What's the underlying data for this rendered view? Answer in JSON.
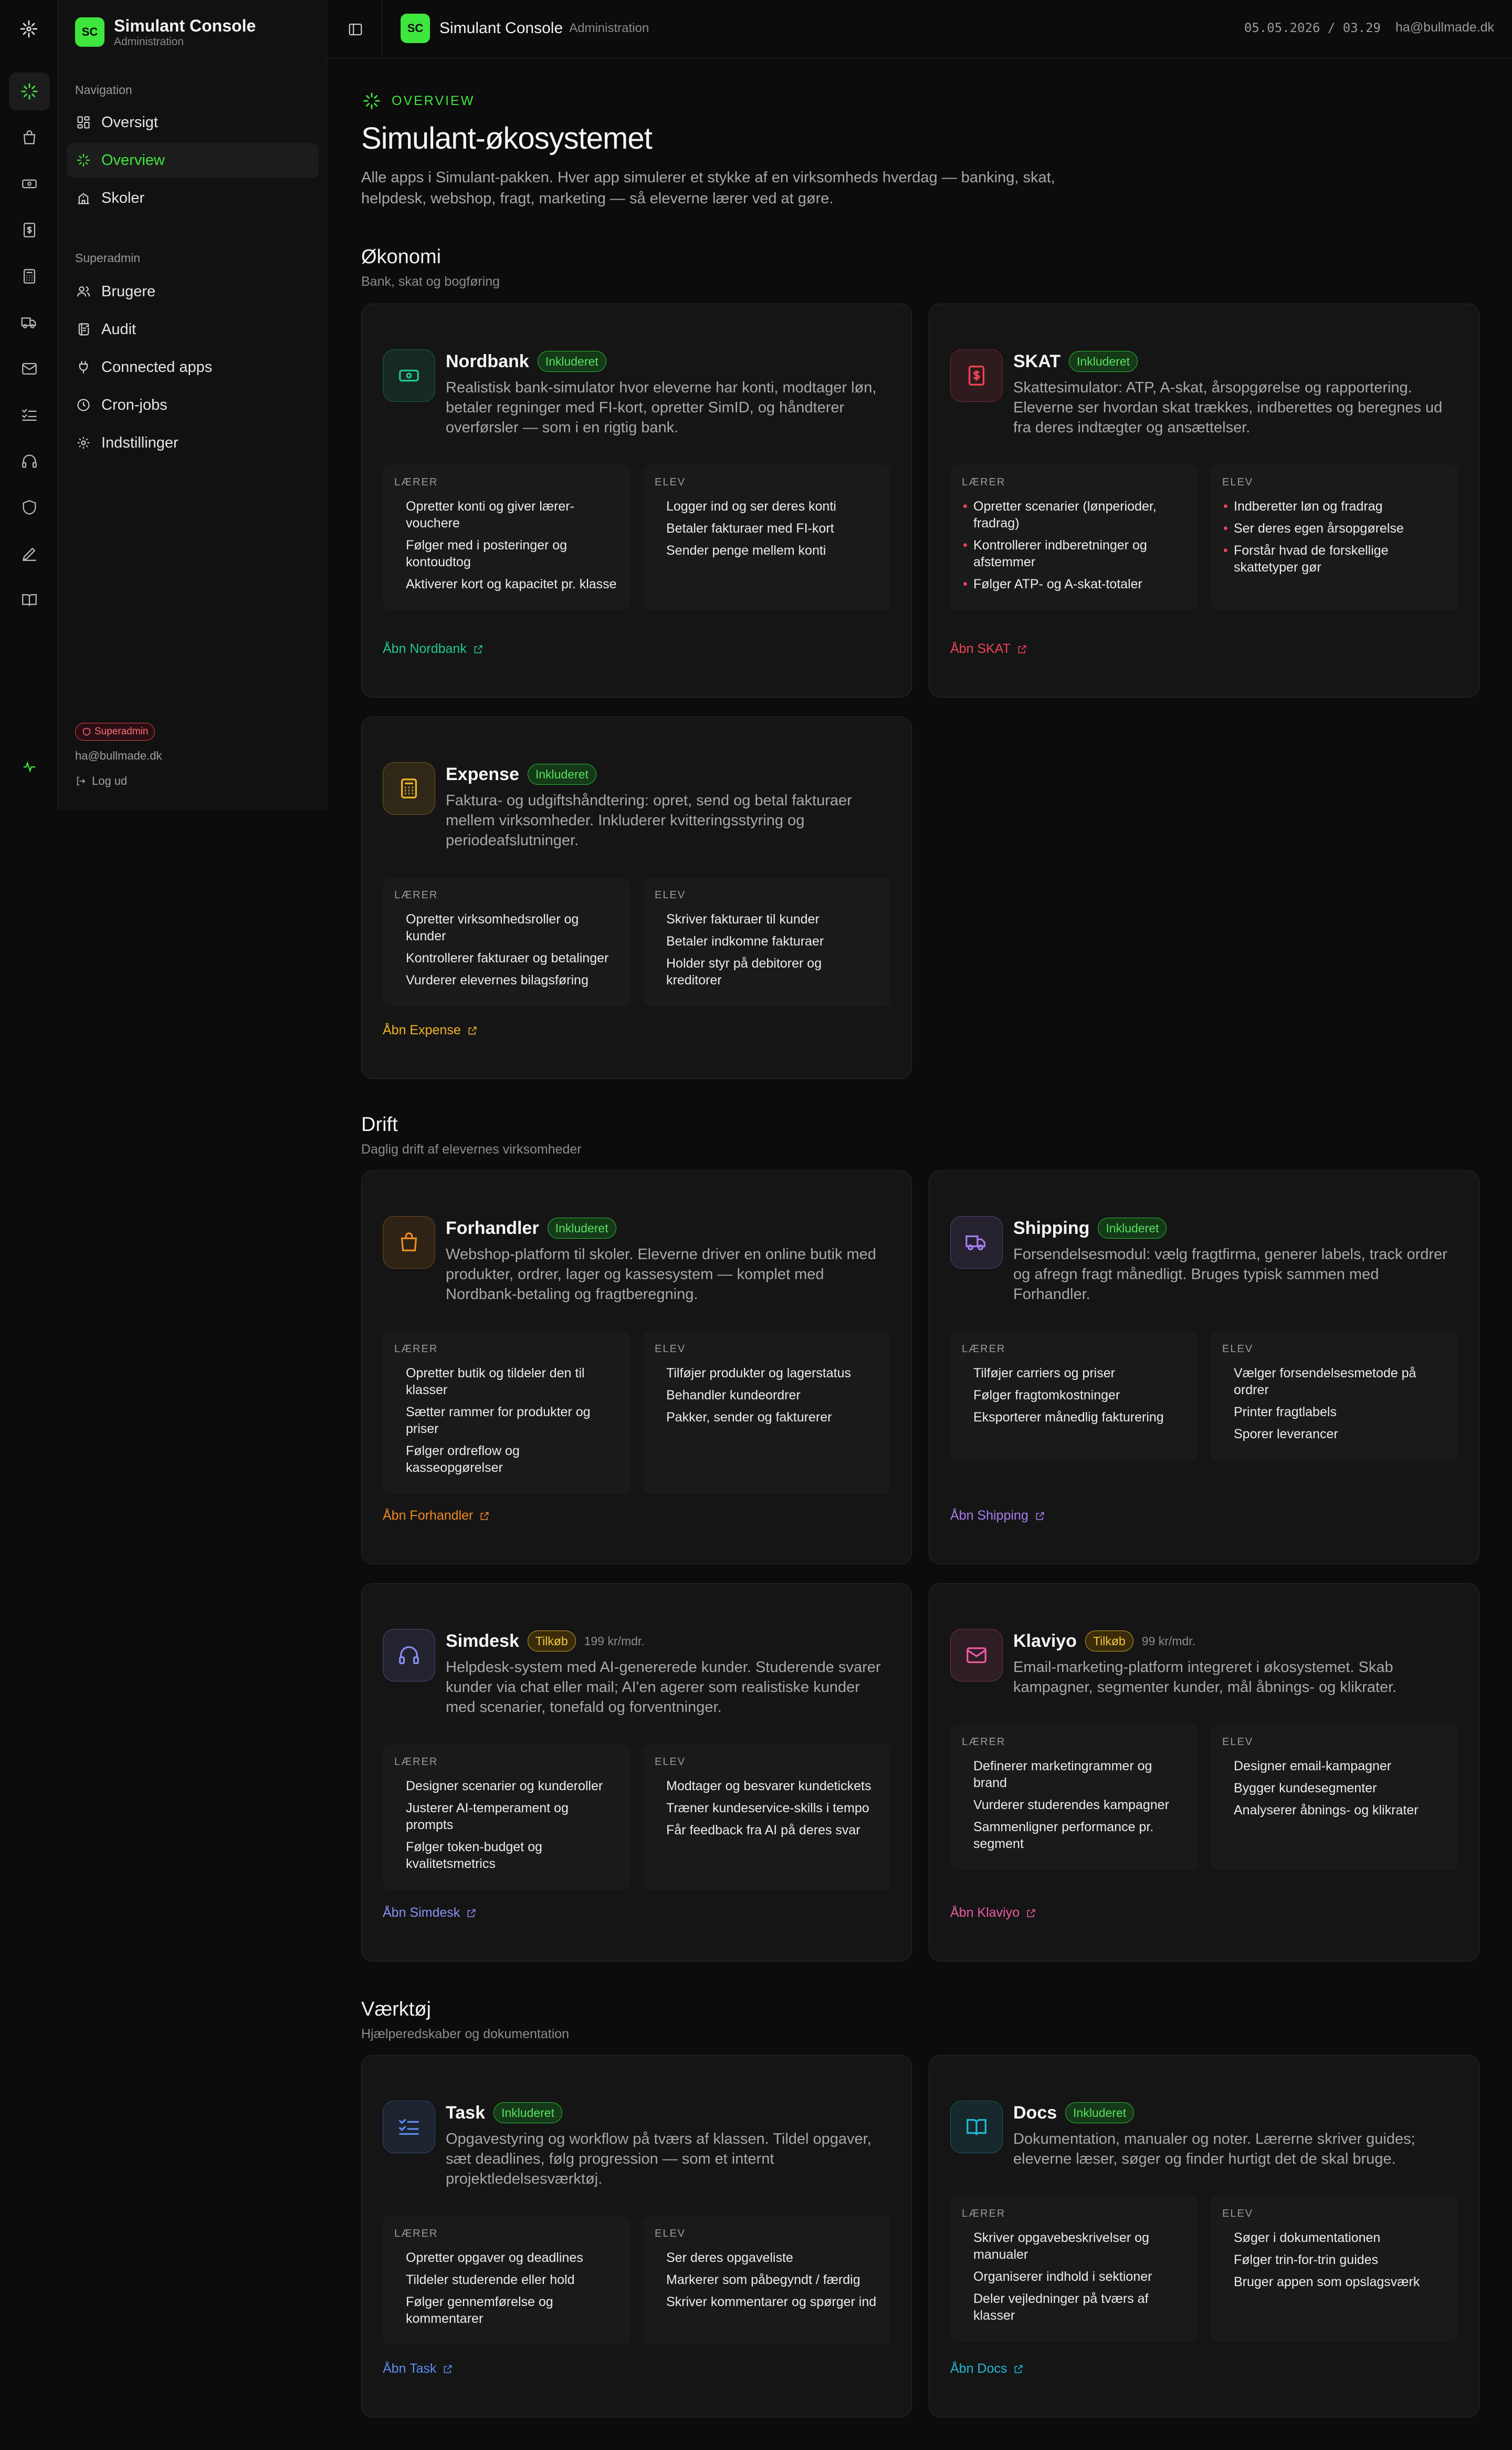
{
  "colors": {
    "accent": "#3ee63e",
    "nordbank": "#22c88a",
    "skat": "#ef4458",
    "expense": "#f0b429",
    "forhandler": "#f08a24",
    "shipping": "#a57cf0",
    "simdesk": "#8b8ff5",
    "klaviyo": "#ee5aa2",
    "task": "#5b8def",
    "docs": "#22b8d6"
  },
  "sidebar": {
    "brand_badge": "SC",
    "brand_title": "Simulant Console",
    "brand_sub": "Administration",
    "nav_label": "Navigation",
    "nav_items": [
      {
        "label": "Oversigt",
        "icon": "grid-icon"
      },
      {
        "label": "Overview",
        "icon": "sparkle-icon"
      },
      {
        "label": "Skoler",
        "icon": "school-icon"
      }
    ],
    "admin_label": "Superadmin",
    "admin_items": [
      {
        "label": "Brugere",
        "icon": "users-icon"
      },
      {
        "label": "Audit",
        "icon": "scroll-icon"
      },
      {
        "label": "Connected apps",
        "icon": "plug-icon"
      },
      {
        "label": "Cron-jobs",
        "icon": "clock-icon"
      },
      {
        "label": "Indstillinger",
        "icon": "gear-icon"
      }
    ],
    "role_badge": "Superadmin",
    "email": "ha@bullmade.dk",
    "logout": "Log ud"
  },
  "topbar": {
    "badge": "SC",
    "title": "Simulant Console",
    "sub": "Administration",
    "datetime": "05.05.2026 / 03.29",
    "email": "ha@bullmade.dk"
  },
  "page": {
    "eyebrow": "OVERVIEW",
    "title": "Simulant-økosystemet",
    "lead": "Alle apps i Simulant-pakken. Hver app simulerer et stykke af en virksomheds hverdag — banking, skat, helpdesk, webshop, fragt, marketing — så eleverne lærer ved at gøre."
  },
  "labels": {
    "teacher": "LÆRER",
    "student": "ELEV"
  },
  "groups": [
    {
      "title": "Økonomi",
      "sub": "Bank, skat og bogføring"
    },
    {
      "title": "Drift",
      "sub": "Daglig drift af elevernes virksomheder"
    },
    {
      "title": "Værktøj",
      "sub": "Hjælperedskaber og dokumentation"
    }
  ],
  "apps": {
    "nordbank": {
      "name": "Nordbank",
      "badge": "Inkluderet",
      "desc": "Realistisk bank-simulator hvor eleverne har konti, modtager løn, betaler regninger med FI-kort, opretter SimID, og håndterer overførsler — som i en rigtig bank.",
      "teacher": [
        "Opretter konti og giver lærer-vouchere",
        "Følger med i posteringer og kontoudtog",
        "Aktiverer kort og kapacitet pr. klasse"
      ],
      "student": [
        "Logger ind og ser deres konti",
        "Betaler fakturaer med FI-kort",
        "Sender penge mellem konti"
      ],
      "link": "Åbn Nordbank"
    },
    "skat": {
      "name": "SKAT",
      "badge": "Inkluderet",
      "desc": "Skattesimulator: ATP, A-skat, årsopgørelse og rapportering. Eleverne ser hvordan skat trækkes, indberettes og beregnes ud fra deres indtægter og ansættelser.",
      "teacher": [
        "Opretter scenarier (lønperioder, fradrag)",
        "Kontrollerer indberetninger og afstemmer",
        "Følger ATP- og A-skat-totaler"
      ],
      "student": [
        "Indberetter løn og fradrag",
        "Ser deres egen årsopgørelse",
        "Forstår hvad de forskellige skattetyper gør"
      ],
      "link": "Åbn SKAT"
    },
    "expense": {
      "name": "Expense",
      "badge": "Inkluderet",
      "desc": "Faktura- og udgiftshåndtering: opret, send og betal fakturaer mellem virksomheder. Inkluderer kvitteringsstyring og periodeafslutninger.",
      "teacher": [
        "Opretter virksomhedsroller og kunder",
        "Kontrollerer fakturaer og betalinger",
        "Vurderer elevernes bilagsføring"
      ],
      "student": [
        "Skriver fakturaer til kunder",
        "Betaler indkomne fakturaer",
        "Holder styr på debitorer og kreditorer"
      ],
      "link": "Åbn Expense"
    },
    "forhandler": {
      "name": "Forhandler",
      "badge": "Inkluderet",
      "desc": "Webshop-platform til skoler. Eleverne driver en online butik med produkter, ordrer, lager og kassesystem — komplet med Nordbank-betaling og fragtberegning.",
      "teacher": [
        "Opretter butik og tildeler den til klasser",
        "Sætter rammer for produkter og priser",
        "Følger ordreflow og kasseopgørelser"
      ],
      "student": [
        "Tilføjer produkter og lagerstatus",
        "Behandler kundeordrer",
        "Pakker, sender og fakturerer"
      ],
      "link": "Åbn Forhandler"
    },
    "shipping": {
      "name": "Shipping",
      "badge": "Inkluderet",
      "desc": "Forsendelsesmodul: vælg fragtfirma, generer labels, track ordrer og afregn fragt månedligt. Bruges typisk sammen med Forhandler.",
      "teacher": [
        "Tilføjer carriers og priser",
        "Følger fragtomkostninger",
        "Eksporterer månedlig fakturering"
      ],
      "student": [
        "Vælger forsendelsesmetode på ordrer",
        "Printer fragtlabels",
        "Sporer leverancer"
      ],
      "link": "Åbn Shipping"
    },
    "simdesk": {
      "name": "Simdesk",
      "badge": "Tilkøb",
      "price": "199 kr/mdr.",
      "desc": "Helpdesk-system med AI-genererede kunder. Studerende svarer kunder via chat eller mail; AI'en agerer som realistiske kunder med scenarier, tonefald og forventninger.",
      "teacher": [
        "Designer scenarier og kunderoller",
        "Justerer AI-temperament og prompts",
        "Følger token-budget og kvalitetsmetrics"
      ],
      "student": [
        "Modtager og besvarer kundetickets",
        "Træner kundeservice-skills i tempo",
        "Får feedback fra AI på deres svar"
      ],
      "link": "Åbn Simdesk"
    },
    "klaviyo": {
      "name": "Klaviyo",
      "badge": "Tilkøb",
      "price": "99 kr/mdr.",
      "desc": "Email-marketing-platform integreret i økosystemet. Skab kampagner, segmenter kunder, mål åbnings- og klikrater.",
      "teacher": [
        "Definerer marketingrammer og brand",
        "Vurderer studerendes kampagner",
        "Sammenligner performance pr. segment"
      ],
      "student": [
        "Designer email-kampagner",
        "Bygger kundesegmenter",
        "Analyserer åbnings- og klikrater"
      ],
      "link": "Åbn Klaviyo"
    },
    "task": {
      "name": "Task",
      "badge": "Inkluderet",
      "desc": "Opgavestyring og workflow på tværs af klassen. Tildel opgaver, sæt deadlines, følg progression — som et internt projektledelsesværktøj.",
      "teacher": [
        "Opretter opgaver og deadlines",
        "Tildeler studerende eller hold",
        "Følger gennemførelse og kommentarer"
      ],
      "student": [
        "Ser deres opgaveliste",
        "Markerer som påbegyndt / færdig",
        "Skriver kommentarer og spørger ind"
      ],
      "link": "Åbn Task"
    },
    "docs": {
      "name": "Docs",
      "badge": "Inkluderet",
      "desc": "Dokumentation, manualer og noter. Lærerne skriver guides; eleverne læser, søger og finder hurtigt det de skal bruge.",
      "teacher": [
        "Skriver opgavebeskrivelser og manualer",
        "Organiserer indhold i sektioner",
        "Deler vejledninger på tværs af klasser"
      ],
      "student": [
        "Søger i dokumentationen",
        "Følger trin-for-trin guides",
        "Bruger appen som opslagsværk"
      ],
      "link": "Åbn Docs"
    }
  }
}
